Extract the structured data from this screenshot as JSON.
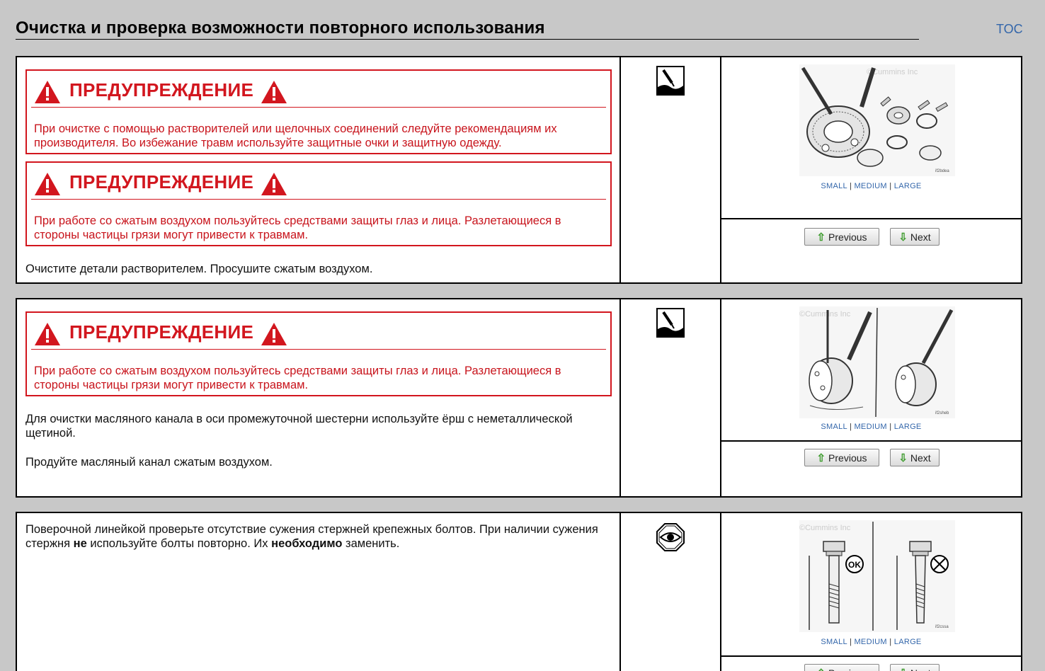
{
  "page": {
    "title": "Очистка и проверка возможности повторного использования",
    "toc_label": "TOC"
  },
  "common": {
    "warning_title": "ПРЕДУПРЕЖДЕНИЕ",
    "size_small": "SMALL",
    "size_medium": "MEDIUM",
    "size_large": "LARGE",
    "size_sep": "|",
    "previous_label": "Previous",
    "next_label": "Next",
    "watermark": "©Cummins Inc"
  },
  "steps": [
    {
      "warnings": [
        "При очистке с помощью растворителей или щелочных соединений следуйте рекомендациям их производителя. Во избежание травм используйте защитные очки и защитную одежду.",
        "При работе со сжатым воздухом пользуйтесь средствами защиты глаз и лица. Разлетающиеся в стороны частицы грязи могут привести к травмам."
      ],
      "text": "Очистите детали растворителем. Просушите сжатым воздухом.",
      "icon": "brush-tool-icon",
      "figure_code": "if2bdea"
    },
    {
      "warnings": [
        "При работе со сжатым воздухом пользуйтесь средствами защиты глаз и лица. Разлетающиеся в стороны частицы грязи могут привести к травмам."
      ],
      "text1": "Для очистки масляного канала в оси промежуточной шестерни используйте ёрш с неметаллической щетиной.",
      "text2": "Продуйте масляный канал сжатым воздухом.",
      "icon": "brush-tool-icon",
      "figure_code": "if2sheb"
    },
    {
      "text_a": "Поверочной линейкой проверьте отсутствие сужения стержней крепежных болтов. При наличии сужения стержня ",
      "text_b": "не",
      "text_c": " используйте болты повторно. Их ",
      "text_d": "необходимо",
      "text_e": " заменить.",
      "icon": "eye-inspect-icon",
      "figure_code": "if2cssa",
      "ok_mark": "OK"
    }
  ]
}
